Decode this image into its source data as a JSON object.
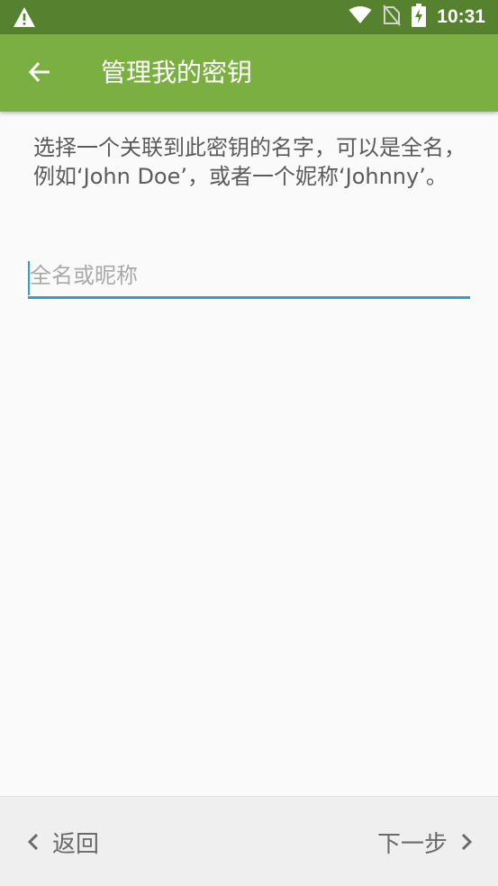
{
  "status_bar": {
    "time": "10:31",
    "icons": [
      "warning-icon",
      "wifi-icon",
      "no-sim-icon",
      "battery-charging-icon"
    ]
  },
  "app_bar": {
    "title": "管理我的密钥",
    "back_icon": "arrow-left-icon",
    "color": "#7caf41"
  },
  "content": {
    "description": "选择一个关联到此密钥的名字，可以是全名，例如‘John Doe’，或者一个妮称‘Johnny’。",
    "name_input": {
      "value": "",
      "placeholder": "全名或昵称"
    }
  },
  "bottom_bar": {
    "back_label": "返回",
    "next_label": "下一步"
  },
  "colors": {
    "status_bar": "#56812f",
    "accent": "#2a9fd8"
  }
}
